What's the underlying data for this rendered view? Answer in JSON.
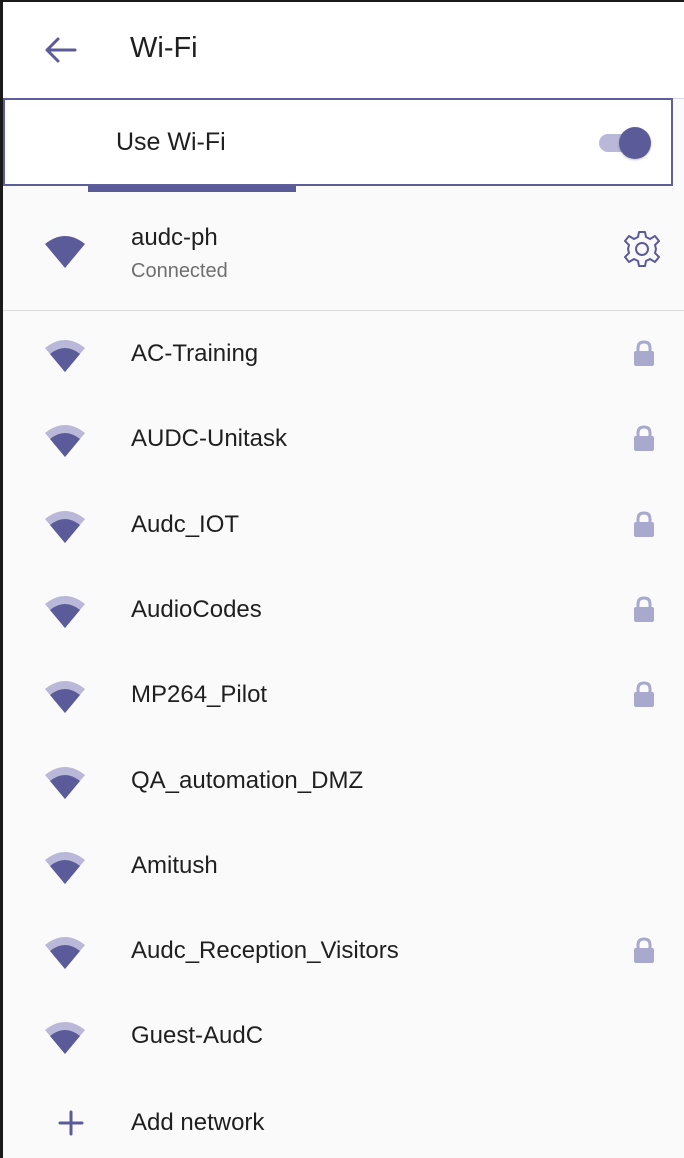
{
  "appbar": {
    "title": "Wi-Fi",
    "back_icon": "arrow-back-icon"
  },
  "master_switch": {
    "label": "Use Wi-Fi",
    "enabled": true
  },
  "colors": {
    "accent": "#5c5b99",
    "accent_light": "#b9b8d8",
    "lock": "#a9a8cd"
  },
  "connected_network": {
    "ssid": "audc-ph",
    "status": "Connected",
    "settings_icon": "gear-icon"
  },
  "networks": [
    {
      "ssid": "AC-Training",
      "secured": true
    },
    {
      "ssid": "AUDC-Unitask",
      "secured": true
    },
    {
      "ssid": "Audc_IOT",
      "secured": true
    },
    {
      "ssid": "AudioCodes",
      "secured": true
    },
    {
      "ssid": "MP264_Pilot",
      "secured": true
    },
    {
      "ssid": "QA_automation_DMZ",
      "secured": false
    },
    {
      "ssid": "Amitush",
      "secured": false
    },
    {
      "ssid": "Audc_Reception_Visitors",
      "secured": true
    },
    {
      "ssid": "Guest-AudC",
      "secured": false
    }
  ],
  "add_network": {
    "label": "Add network",
    "icon": "plus-icon"
  }
}
